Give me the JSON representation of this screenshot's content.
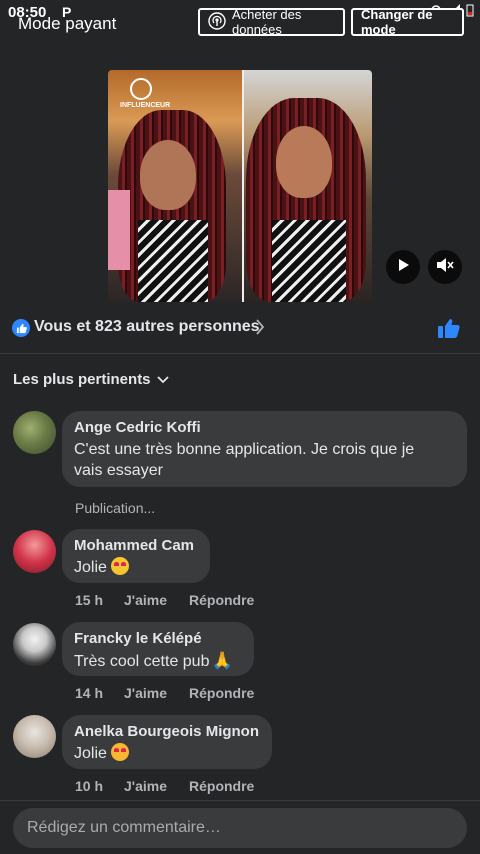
{
  "status_bar": {
    "time": "08:50",
    "indicator": "P",
    "icons": [
      "headphones-icon",
      "signal-icon",
      "battery-icon"
    ]
  },
  "header": {
    "mode_title": "Mode payant",
    "buy_data_label": "Acheter des données",
    "change_mode_label": "Changer de mode"
  },
  "video": {
    "logo_text": "INFLUENCEUR",
    "controls": [
      "play-icon",
      "mute-icon"
    ]
  },
  "reactions": {
    "summary": "Vous et 823 autres personnes"
  },
  "sort": {
    "label": "Les plus pertinents"
  },
  "comments": [
    {
      "author": "Ange Cedric Koffi",
      "text_line1": "C'est une très bonne application. Je crois que je",
      "text_line2": "vais essayer",
      "footer": "Publication..."
    },
    {
      "author": "Mohammed Cam",
      "text": "Jolie",
      "time": "15 h",
      "like": "J'aime",
      "reply": "Répondre"
    },
    {
      "author": "Francky le Kélépé",
      "text": "Très cool cette pub",
      "time": "14 h",
      "like": "J'aime",
      "reply": "Répondre"
    },
    {
      "author": "Anelka Bourgeois Mignon",
      "text": "Jolie",
      "time": "10 h",
      "like": "J'aime",
      "reply": "Répondre"
    }
  ],
  "composer": {
    "placeholder": "Rédigez un commentaire…"
  },
  "colors": {
    "background": "#242526",
    "bubble": "#3a3b3c",
    "accent": "#2d88ff",
    "muted": "#b0b3b8"
  }
}
